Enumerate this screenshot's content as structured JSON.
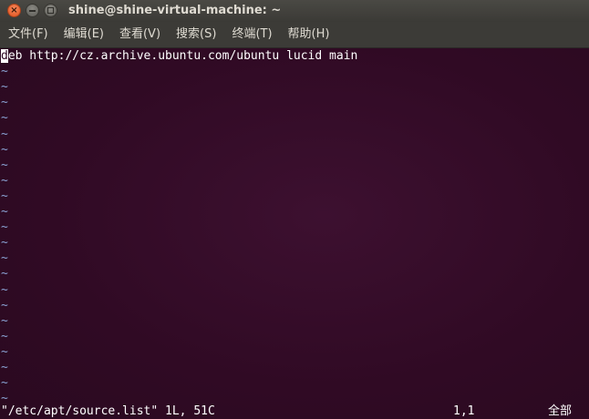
{
  "window": {
    "title": "shine@shine-virtual-machine: ~",
    "close_glyph": "×"
  },
  "menu": {
    "items": [
      "文件(F)",
      "编辑(E)",
      "查看(V)",
      "搜索(S)",
      "终端(T)",
      "帮助(H)"
    ]
  },
  "editor": {
    "cursor_char": "d",
    "line1_rest": "eb http://cz.archive.ubuntu.com/ubuntu lucid main",
    "tilde": "~",
    "empty_line_count": 22
  },
  "status": {
    "file": "\"/etc/apt/source.list\" 1L, 51C",
    "position": "1,1",
    "scroll": "全部"
  },
  "colors": {
    "terminal_bg": "#300a24",
    "tilde": "#8aa3d4",
    "close_button": "#e0531f"
  }
}
